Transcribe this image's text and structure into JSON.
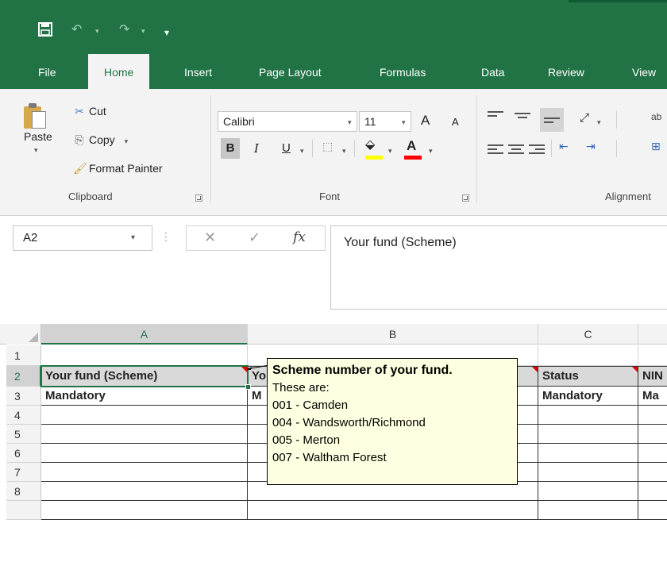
{
  "qat": {
    "save_icon": "save-icon",
    "undo_icon": "undo-icon",
    "redo_icon": "redo-icon",
    "customize_icon": "qat-customize-icon"
  },
  "tabs": [
    {
      "label": "File"
    },
    {
      "label": "Home"
    },
    {
      "label": "Insert"
    },
    {
      "label": "Page Layout"
    },
    {
      "label": "Formulas"
    },
    {
      "label": "Data"
    },
    {
      "label": "Review"
    },
    {
      "label": "View"
    }
  ],
  "clipboard": {
    "paste_label": "Paste",
    "cut_label": "Cut",
    "copy_label": "Copy",
    "format_painter_label": "Format Painter",
    "group_label": "Clipboard"
  },
  "font": {
    "font_name": "Calibri",
    "font_size": "11",
    "grow_label": "A",
    "shrink_label": "A",
    "bold_label": "B",
    "italic_label": "I",
    "underline_label": "U",
    "font_color_label": "A",
    "group_label": "Font"
  },
  "alignment": {
    "group_label": "Alignment",
    "wrap_label": "ab"
  },
  "formula_bar": {
    "name_box": "A2",
    "fx_label": "fx",
    "cancel_glyph": "✕",
    "enter_glyph": "✓",
    "formula": "Your fund (Scheme)"
  },
  "grid": {
    "columns": [
      "A",
      "B",
      "C"
    ],
    "rows": [
      "1",
      "2",
      "3",
      "4",
      "5",
      "6",
      "7",
      "8"
    ],
    "cells": {
      "A2": "Your fund (Scheme)",
      "B2": "Yo",
      "C2": "Status",
      "D2": "NIN",
      "A3": "Mandatory",
      "B3": "M",
      "C3": "Mandatory",
      "D3": "Ma"
    }
  },
  "comment": {
    "title": "Scheme number of your fund.",
    "lines": [
      "These are:",
      "001 - Camden",
      "004 - Wandsworth/Richmond",
      "005 - Merton",
      "007 - Waltham Forest"
    ]
  },
  "colors": {
    "accent": "#217346",
    "comment_bg": "#ffffe1",
    "comment_marker": "#e00000"
  }
}
